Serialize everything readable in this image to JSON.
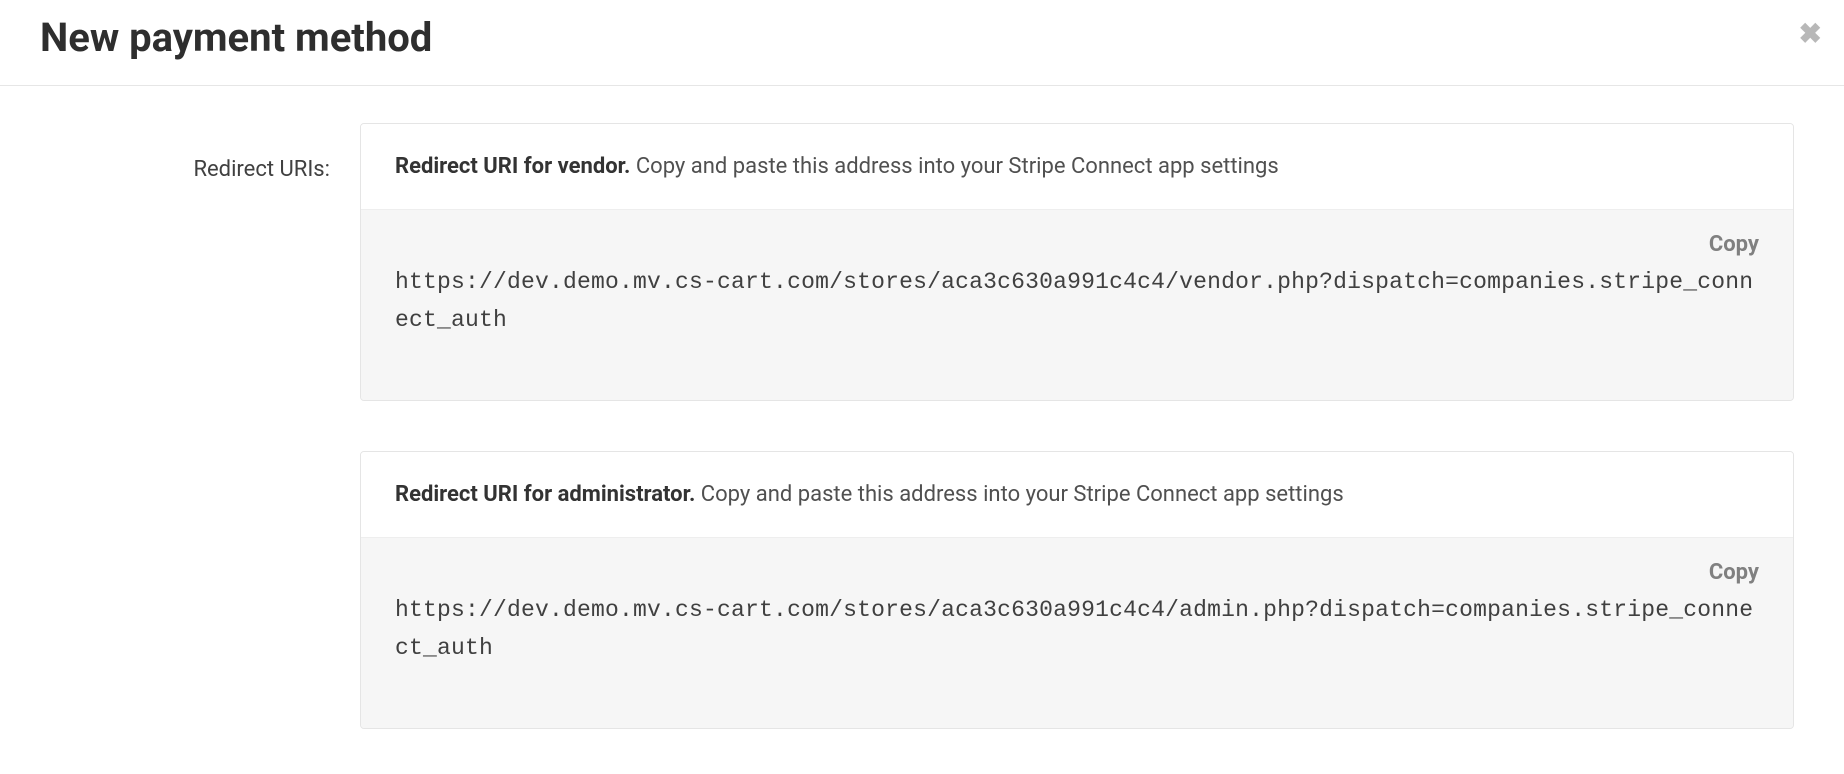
{
  "header": {
    "title": "New payment method",
    "close_glyph": "✖"
  },
  "field_label": "Redirect URIs:",
  "copy_label": "Copy",
  "blocks": [
    {
      "title_bold": "Redirect URI for vendor.",
      "title_rest": " Copy and paste this address into your Stripe Connect app settings",
      "uri": "https://dev.demo.mv.cs-cart.com/stores/aca3c630a991c4c4/vendor.php?dispatch=companies.stripe_connect_auth"
    },
    {
      "title_bold": "Redirect URI for administrator.",
      "title_rest": " Copy and paste this address into your Stripe Connect app settings",
      "uri": "https://dev.demo.mv.cs-cart.com/stores/aca3c630a991c4c4/admin.php?dispatch=companies.stripe_connect_auth"
    }
  ]
}
